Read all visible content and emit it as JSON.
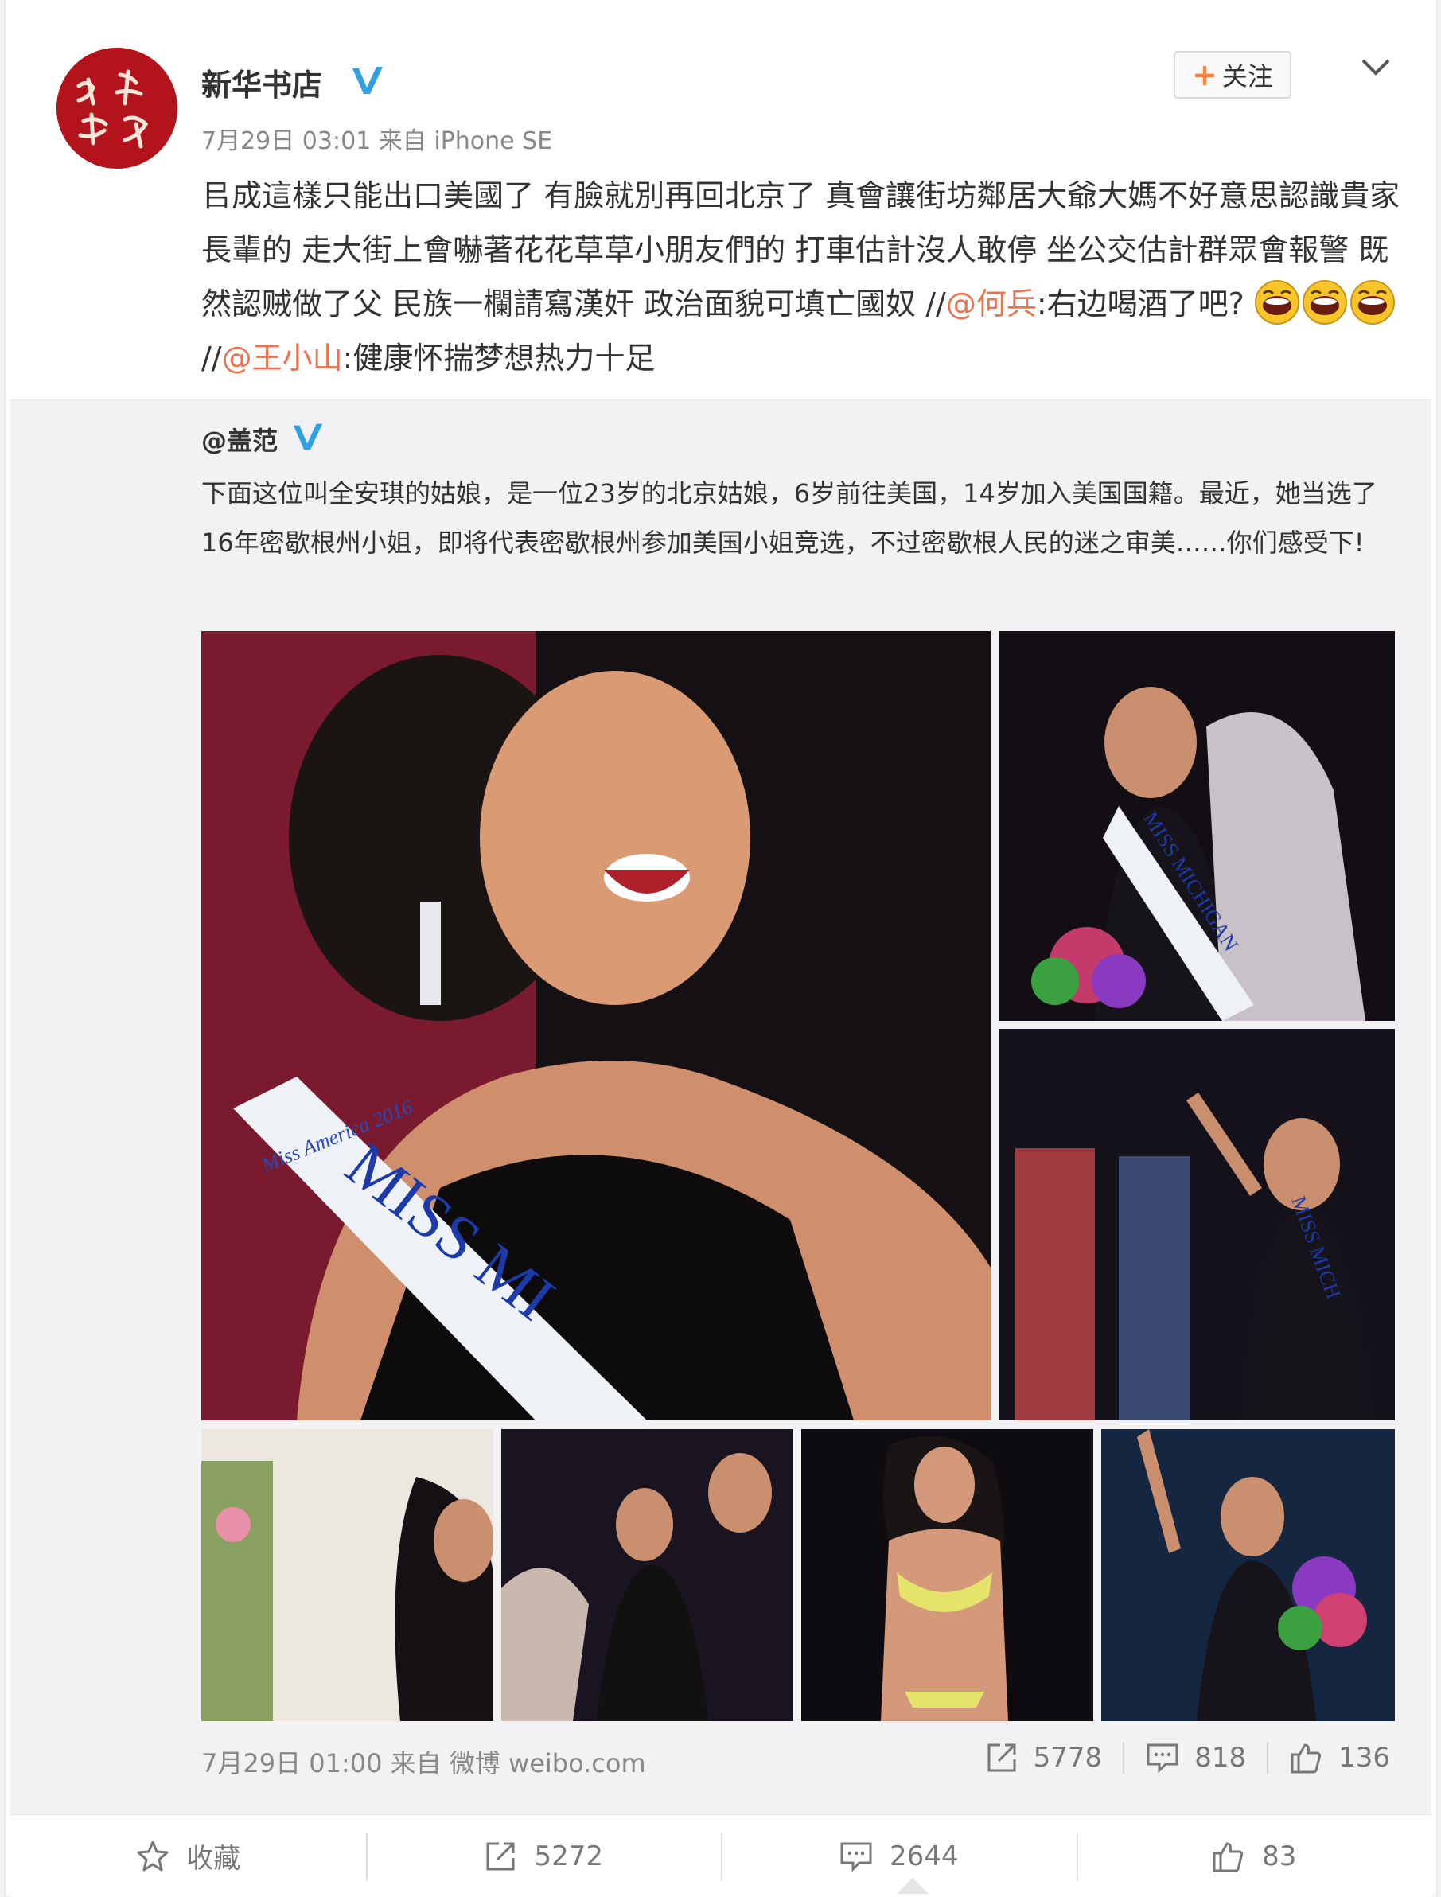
{
  "post": {
    "username": "新华书店",
    "timestamp": "7月29日 03:01",
    "source_prefix": "来自",
    "source": "iPhone SE",
    "follow_label": "关注",
    "text_lead": "㠯",
    "text_main": "成這樣只能出口美國了 有臉就別再回北京了 真會讓街坊鄰居大爺大媽不好意思認識貴家長輩的 走大街上會嚇著花花草草小朋友們的 打車估計沒人敢停 坐公交估計群眾會報警 既然認贼做了父 民族一欄請寫漢奸 政治面貌可填亡國奴 //",
    "mention1": "@何兵",
    "text_after_mention1": ":右边喝酒了吧?",
    "sep2": " //",
    "mention2": "@王小山",
    "text_after_mention2": ":健康怀揣梦想热力十足"
  },
  "repost": {
    "username": "@盖范",
    "text": "下面这位叫全安琪的姑娘，是一位23岁的北京姑娘，6岁前往美国，14岁加入美国国籍。最近，她当选了16年密歇根州小姐，即将代表密歇根州参加美国小姐竞选，不过密歇根人民的迷之审美……你们感受下!",
    "photos": [
      {
        "name": "photo-main-closeup",
        "sash": "MISS MI",
        "sash_top": "Miss America 2016"
      },
      {
        "name": "photo-crowning",
        "sash": "MISS MICHIGAN"
      },
      {
        "name": "photo-waving",
        "sash": "MISS MICH"
      },
      {
        "name": "photo-side-profile"
      },
      {
        "name": "photo-celebration"
      },
      {
        "name": "photo-swimsuit"
      },
      {
        "name": "photo-waving-bouquet"
      }
    ],
    "timestamp": "7月29日 01:00",
    "source_prefix": "来自",
    "source": "微博 weibo.com",
    "repost_count": "5778",
    "comment_count": "818",
    "like_count": "136"
  },
  "actions": {
    "favorite_label": "收藏",
    "repost_count": "5272",
    "comment_count": "2644",
    "like_count": "83"
  },
  "colors": {
    "accent_link": "#eb7350",
    "follow_plus": "#ff8140",
    "verify_blue": "#2fa0e0",
    "avatar_red": "#b3141b"
  }
}
